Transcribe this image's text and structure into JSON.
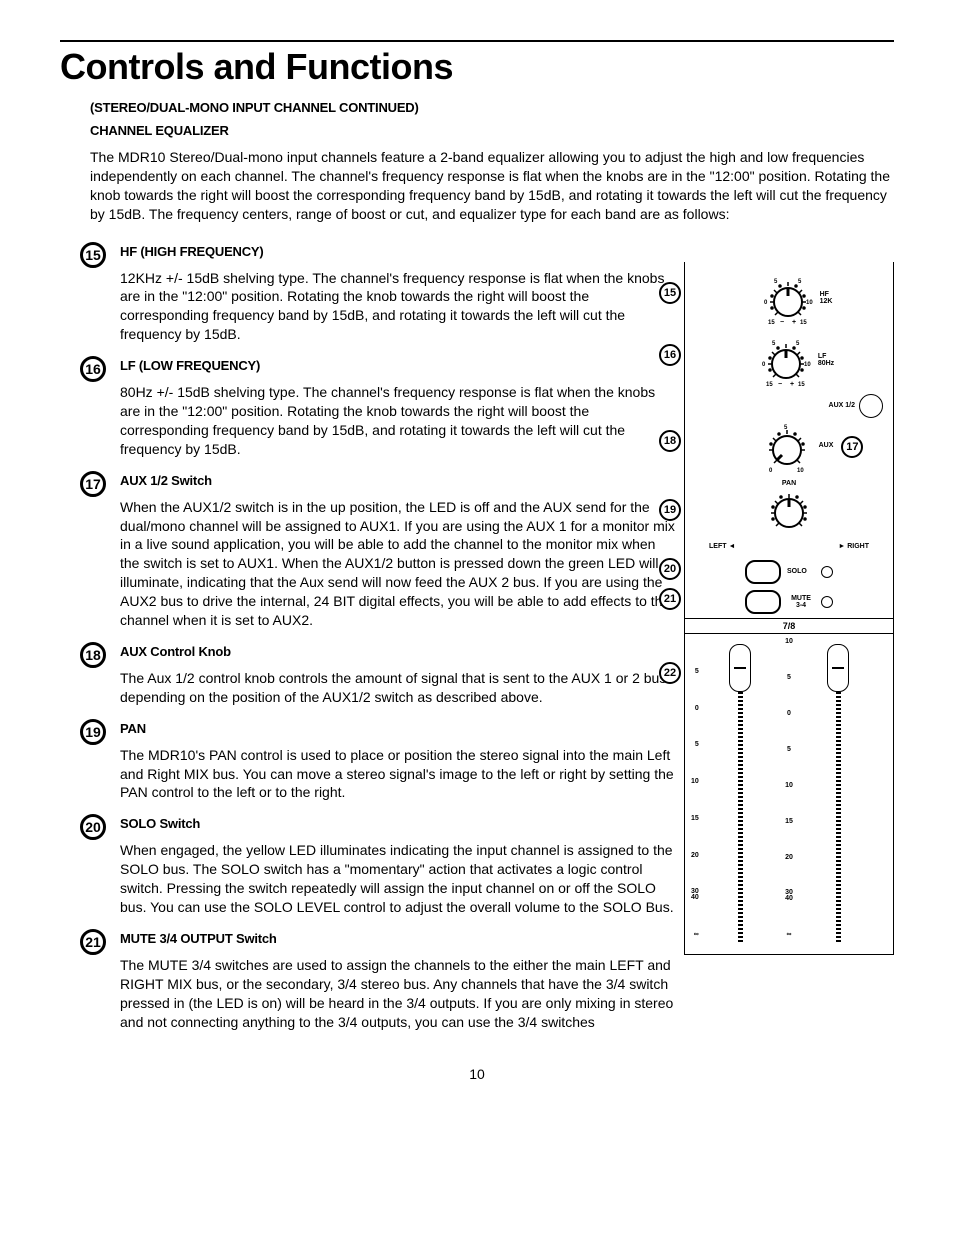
{
  "page_title": "Controls and Functions",
  "continued": "(STEREO/DUAL-MONO INPUT CHANNEL CONTINUED)",
  "section_heading": "CHANNEL EQUALIZER",
  "intro": "The MDR10 Stereo/Dual-mono input channels feature a 2-band equalizer allowing you to adjust the high and low frequencies independently on each channel. The channel's frequency response is flat when the knobs are in the \"12:00\" position. Rotating the knob towards the right will boost the corresponding frequency band by 15dB, and rotating it towards the left will cut the frequency by 15dB. The frequency centers, range of boost or cut, and equalizer type for each band are as follows:",
  "items": [
    {
      "num": "15",
      "title": "HF (HIGH FREQUENCY)",
      "body": "12KHz +/- 15dB shelving type. The channel's frequency response is flat when the knobs are in the \"12:00\" position. Rotating the knob towards the right will boost the corresponding frequency band by 15dB, and rotating it towards the left will cut the frequency by 15dB."
    },
    {
      "num": "16",
      "title": "LF (LOW FREQUENCY)",
      "body": "80Hz +/- 15dB shelving type. The channel's frequency response is flat when the knobs are in the \"12:00\" position. Rotating the knob towards the right will boost the corresponding frequency band by 15dB, and rotating it towards the left will cut the frequency by 15dB."
    },
    {
      "num": "17",
      "title": "AUX 1/2 Switch",
      "body": "When the AUX1/2 switch is in the up position, the LED is off and the AUX send for the dual/mono channel will be assigned to AUX1. If you are using the AUX 1 for a monitor mix in a live sound application, you will be able to add the channel to the monitor mix when the switch is set to AUX1. When the AUX1/2 button is pressed down the green LED will illuminate, indicating that the Aux send will now feed the AUX 2 bus.  If you are using the AUX2 bus to drive the internal, 24 BIT digital effects, you will be able to add effects to the channel when it is set to AUX2."
    },
    {
      "num": "18",
      "title": "AUX Control Knob",
      "body": "The Aux 1/2 control knob controls the amount of signal that is sent to the AUX 1 or 2 bus depending on the position of the AUX1/2 switch as described above."
    },
    {
      "num": "19",
      "title": "PAN",
      "body": "The MDR10's PAN control is used to place or position the stereo signal into the main Left and Right MIX bus. You can move a stereo signal's image to the left or right by setting the PAN control to the left or to the right."
    },
    {
      "num": "20",
      "title": "SOLO Switch",
      "body": "When engaged, the yellow LED illuminates indicating the input channel is assigned to the SOLO bus. The SOLO switch has a \"momentary\" action that activates a logic control switch. Pressing the switch repeatedly will assign the input channel on or off the SOLO bus. You can use the SOLO LEVEL control to adjust the overall volume to the SOLO Bus."
    },
    {
      "num": "21",
      "title": "MUTE 3/4 OUTPUT Switch",
      "body": "The MUTE 3/4 switches are used to assign the channels to the either the main LEFT and RIGHT MIX bus, or the secondary, 3/4 stereo bus. Any channels that have the 3/4 switch pressed in (the LED is on) will be heard in the 3/4 outputs. If you are only mixing in stereo and not connecting anything to the 3/4 outputs, you can use the 3/4 switches"
    }
  ],
  "strip": {
    "hf": {
      "label1": "HF",
      "label2": "12K",
      "min": "15",
      "plus": "+",
      "minus": "−",
      "max": "15",
      "ticks_l": "5",
      "ticks_r": "5",
      "mid_l": "0",
      "mid_r": "10"
    },
    "lf": {
      "label1": "LF",
      "label2": "80Hz",
      "min": "15",
      "plus": "+",
      "minus": "−",
      "max": "15",
      "ticks_l": "5",
      "ticks_r": "5",
      "mid_l": "0",
      "mid_r": "10"
    },
    "aux": {
      "label": "AUX 1/2",
      "label2": "AUX",
      "min": "0",
      "max": "10",
      "top": "5"
    },
    "pan": {
      "label": "PAN",
      "left": "LEFT",
      "right": "RIGHT"
    },
    "solo": {
      "label": "SOLO"
    },
    "mute": {
      "label1": "MUTE",
      "label2": "3-4"
    },
    "channel": "7/8",
    "fader_scale": [
      "10",
      "5",
      "0",
      "5",
      "10",
      "15",
      "20",
      "30",
      "40",
      "∞"
    ],
    "callouts": {
      "c15": "15",
      "c16": "16",
      "c17": "17",
      "c18": "18",
      "c19": "19",
      "c20": "20",
      "c21": "21",
      "c22": "22"
    }
  },
  "page_number": "10"
}
